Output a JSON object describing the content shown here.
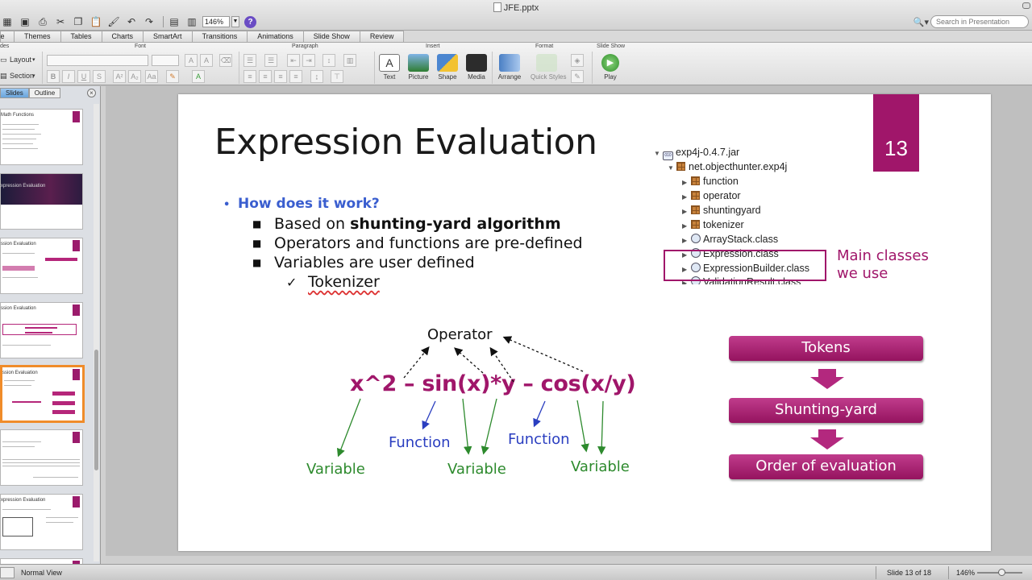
{
  "window": {
    "title": "JFE.pptx",
    "zoom": "146%"
  },
  "search": {
    "placeholder": "Search in Presentation"
  },
  "ribbon_tabs": [
    "me",
    "Themes",
    "Tables",
    "Charts",
    "SmartArt",
    "Transitions",
    "Animations",
    "Slide Show",
    "Review"
  ],
  "ribbon": {
    "groups": {
      "slides": "des",
      "font": "Font",
      "paragraph": "Paragraph",
      "insert": "Insert",
      "format": "Format",
      "slideshow": "Slide Show"
    },
    "layout": "Layout",
    "section": "Section",
    "buttons": {
      "text": "Text",
      "picture": "Picture",
      "shape": "Shape",
      "media": "Media",
      "arrange": "Arrange",
      "quick_styles": "Quick Styles",
      "play": "Play"
    }
  },
  "panel": {
    "tabs": {
      "slides": "Slides",
      "outline": "Outline"
    },
    "thumbs": [
      {
        "title": "Math Functions"
      },
      {
        "title": "xpression Evaluation"
      },
      {
        "title": "ssion Evaluation"
      },
      {
        "title": "ssion Evaluation"
      },
      {
        "title": "ssion Evaluation"
      },
      {
        "title": ""
      },
      {
        "title": "xpression Evaluation"
      },
      {
        "title": ""
      }
    ]
  },
  "slide": {
    "title": "Expression Evaluation",
    "number": "13",
    "bullet_main": "How does it work?",
    "bullet_1_prefix": "Based on ",
    "bullet_1_bold": "shunting-yard algorithm",
    "bullet_2": "Operators and functions are pre-defined",
    "bullet_3": "Variables are user defined",
    "bullet_4": "Tokenizer",
    "tree": {
      "jar": "exp4j-0.4.7.jar",
      "package": "net.objecthunter.exp4j",
      "items": [
        "function",
        "operator",
        "shuntingyard",
        "tokenizer"
      ],
      "classes": [
        "ArrayStack.class",
        "Expression.class",
        "ExpressionBuilder.class",
        "ValidationResult.class"
      ],
      "jar_badge": "010"
    },
    "main_classes_line1": "Main classes",
    "main_classes_line2": "we use",
    "operator_label": "Operator",
    "expression": "x^2 – sin(x)*y – cos(x/y)",
    "function_label": "Function",
    "variable_label": "Variable",
    "flow": [
      "Tokens",
      "Shunting-yard",
      "Order of evaluation"
    ]
  },
  "status": {
    "view": "Normal View",
    "slide": "Slide 13 of 18",
    "zoom": "146%"
  },
  "colors": {
    "accent": "#a0166a",
    "function_blue": "#2a3ec0",
    "variable_green": "#2d8a2d",
    "bullet_blue": "#3a5ecf"
  }
}
